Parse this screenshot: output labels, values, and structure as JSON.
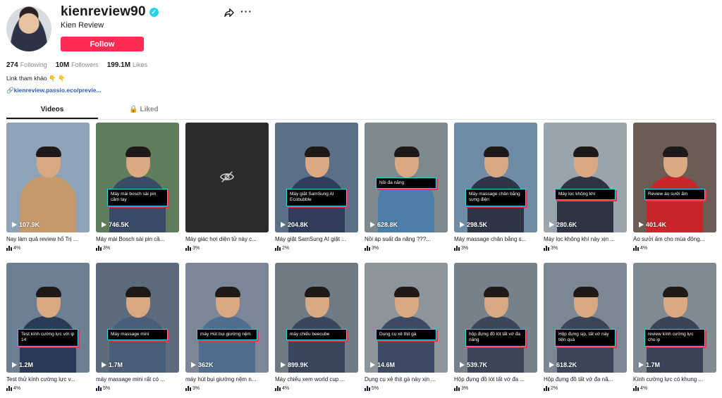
{
  "profile": {
    "username": "kienreview90",
    "nickname": "Kien Review",
    "follow_label": "Follow",
    "stats": [
      {
        "value": "274",
        "label": "Following"
      },
      {
        "value": "10M",
        "label": "Followers"
      },
      {
        "value": "199.1M",
        "label": "Likes"
      }
    ],
    "bio": "Link tham khảo 👇 👇",
    "link": "kienreview.passio.eco/previe..."
  },
  "tabs": {
    "videos": "Videos",
    "liked": "Liked"
  },
  "icons": {
    "share": "share-icon",
    "more": "more-icon",
    "lock": "lock-icon",
    "link": "link-icon",
    "verified": "verified-badge-icon",
    "play": "play-icon",
    "hidden": "eye-off-icon"
  },
  "colors": {
    "accent": "#fe2c55",
    "caption_border": "#25d8e8",
    "verified": "#20d5ec",
    "link": "#2b5db9"
  },
  "videos": [
    {
      "views": "107.9K",
      "desc": "Nay làm quả review hổ Trị ...",
      "stat": "4%",
      "caption": "",
      "bg": "#8fa3b8",
      "shirt": "#c49a6c",
      "hidden": false
    },
    {
      "views": "746.5K",
      "desc": "Máy mài Bosch sài pin cầ...",
      "stat": "3%",
      "caption": "Máy mài bosch sài pin cầm tay",
      "bg": "#5f7d5c",
      "shirt": "#3b4a66",
      "hidden": false
    },
    {
      "views": "",
      "desc": "Máy giác hơi diện tử này c...",
      "stat": "3%",
      "caption": "",
      "bg": "#2b2b2d",
      "shirt": "",
      "hidden": true
    },
    {
      "views": "204.8K",
      "desc": "Máy giặt SamSung AI giặt ...",
      "stat": "2%",
      "caption": "Máy giặt SamSung AI Ecobubble",
      "bg": "#5b6f86",
      "shirt": "#2f3d5a",
      "hidden": false
    },
    {
      "views": "628.8K",
      "desc": "Nồi áp suất đa năng ???...",
      "stat": "3%",
      "caption": "Nồi đa năng",
      "bg": "#7c8a8f",
      "shirt": "#4c7ea8",
      "hidden": false
    },
    {
      "views": "298.5K",
      "desc": "Máy massage chân bằng s...",
      "stat": "3%",
      "caption": "Máy massage chân bằng sưng điện",
      "bg": "#6f8ba5",
      "shirt": "#2e3547",
      "hidden": false
    },
    {
      "views": "280.6K",
      "desc": "Máy lọc không khí này xịn ...",
      "stat": "3%",
      "caption": "Máy lọc không khí",
      "bg": "#9aa4ad",
      "shirt": "#2e3444",
      "hidden": false
    },
    {
      "views": "401.4K",
      "desc": "Áo sưởi ấm cho mùa đông...",
      "stat": "4%",
      "caption": "Review áo sưởi ấm",
      "bg": "#6c5c53",
      "shirt": "#c8262b",
      "hidden": false
    },
    {
      "views": "1.2M",
      "desc": "Test thử kính cường lực v...",
      "stat": "4%",
      "caption": "Test kính cường lực với ip 14",
      "bg": "#6d7f92",
      "shirt": "#2b3a55",
      "hidden": false
    },
    {
      "views": "1.7M",
      "desc": "máy massage mini rất có ...",
      "stat": "5%",
      "caption": "Máy massage mini",
      "bg": "#5d6c7c",
      "shirt": "#4a5d78",
      "hidden": false
    },
    {
      "views": "362K",
      "desc": "máy hút bụi giường nệm n...",
      "stat": "3%",
      "caption": "máy Hút bụi giường nệm",
      "bg": "#7b8696",
      "shirt": "#4f6d8f",
      "hidden": false
    },
    {
      "views": "899.9K",
      "desc": "Máy chiếu xem world cup ...",
      "stat": "4%",
      "caption": "máy chiếu beecube",
      "bg": "#6e7b85",
      "shirt": "#39465b",
      "hidden": false
    },
    {
      "views": "14.6M",
      "desc": "Dụng cụ xẻ thịt gà này xịn ...",
      "stat": "5%",
      "caption": "Dụng cụ xẻ thịt gà",
      "bg": "#8d959c",
      "shirt": "#3c4b63",
      "hidden": false
    },
    {
      "views": "539.7K",
      "desc": "Hộp đựng đồ lót tất vớ đa ...",
      "stat": "3%",
      "caption": "hộp đựng đồ lót tất vớ đa năng",
      "bg": "#75818b",
      "shirt": "#3b4658",
      "hidden": false
    },
    {
      "views": "618.2K",
      "desc": "Hộp đựng đồ tất vớ đa nă...",
      "stat": "2%",
      "caption": "Hộp đựng sịp, tất vớ này tiện quá",
      "bg": "#7b8792",
      "shirt": "#3a4557",
      "hidden": false
    },
    {
      "views": "1.7M",
      "desc": "Kính cường lực có khung ...",
      "stat": "4%",
      "caption": "review kính cường lực cho ip",
      "bg": "#808a93",
      "shirt": "#3a4456",
      "hidden": false
    }
  ]
}
